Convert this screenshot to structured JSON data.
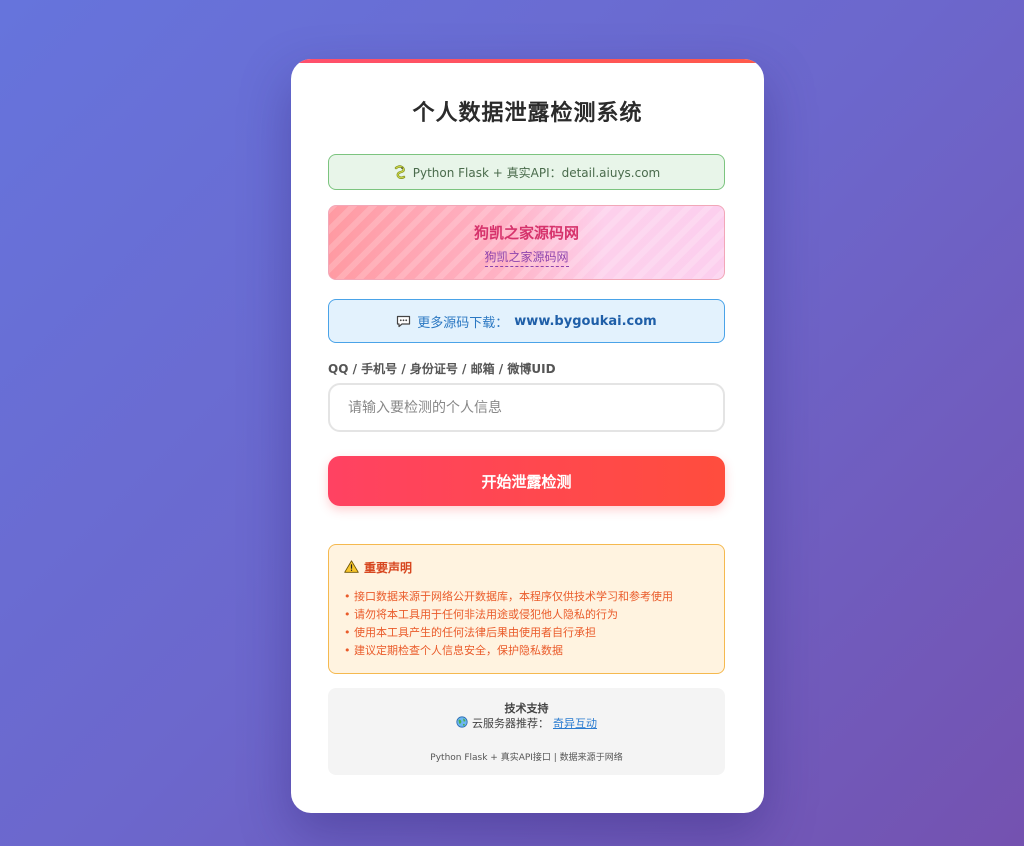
{
  "app": {
    "title": "个人数据泄露检测系统"
  },
  "tech_banner": {
    "icon": "snake-icon",
    "text": "Python Flask + 真实API：detail.aiuys.com"
  },
  "ad_banner": {
    "title": "狗凯之家源码网",
    "link_text": "狗凯之家源码网"
  },
  "download_banner": {
    "icon": "chat-bubble-icon",
    "prefix": "更多源码下载：",
    "url": "www.bygoukai.com"
  },
  "form": {
    "label": "QQ / 手机号 / 身份证号 / 邮箱 / 微博UID",
    "input_value": "",
    "input_placeholder": "请输入要检测的个人信息",
    "submit_label": "开始泄露检测"
  },
  "notice": {
    "icon": "warning-icon",
    "title": "重要声明",
    "items": [
      "接口数据来源于网络公开数据库，本程序仅供技术学习和参考使用",
      "请勿将本工具用于任何非法用途或侵犯他人隐私的行为",
      "使用本工具产生的任何法律后果由使用者自行承担",
      "建议定期检查个人信息安全，保护隐私数据"
    ]
  },
  "footer": {
    "title": "技术支持",
    "icon": "globe-icon",
    "server_prefix": "云服务器推荐：",
    "server_link": "奇异互动",
    "meta": "Python Flask + 真实API接口 | 数据来源于网络"
  },
  "colors": {
    "background_start": "#6674dc",
    "background_end": "#7452b0",
    "accent_red": "#ff4262",
    "notice_orange": "#ea5b2a",
    "tech_green": "#7cc47f",
    "download_blue": "#4aa3e8"
  }
}
